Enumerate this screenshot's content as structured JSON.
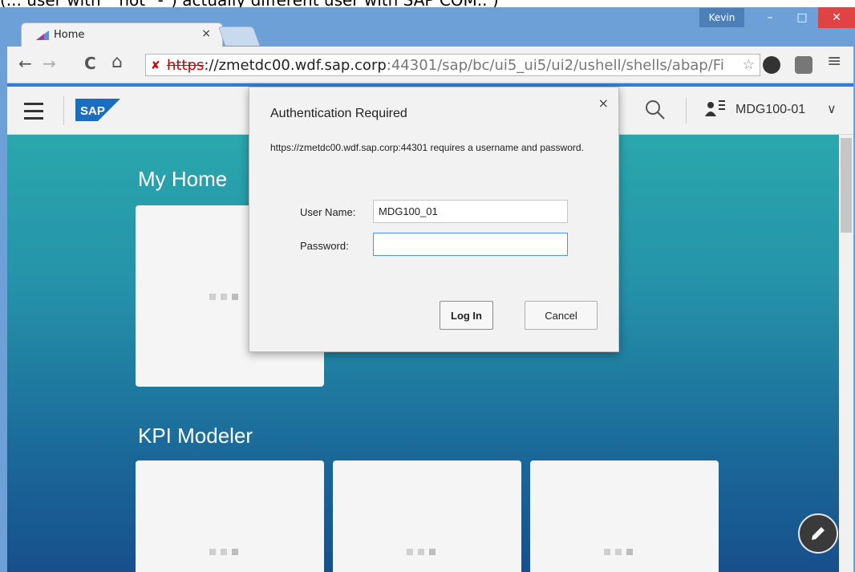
{
  "caption": {
    "prefix": "(... user with ",
    "underscore": "_",
    "suffix": " not \"-\") actually different user with SAP COM.. )"
  },
  "window": {
    "user_badge": "Kevin",
    "minimize_glyph": "–",
    "maximize_glyph": "□",
    "close_glyph": "✕"
  },
  "tab": {
    "title": "Home",
    "close_glyph": "×"
  },
  "toolbar": {
    "back_glyph": "←",
    "forward_glyph": "→",
    "reload_glyph": "C",
    "home_glyph": "⌂",
    "url_scheme": "https",
    "url_host": "://zmetdc00.wdf.sap.corp",
    "url_rest": ":44301/sap/bc/ui5_ui5/ui2/ushell/shells/abap/Fi",
    "star_glyph": "☆",
    "menu_glyph": "≡"
  },
  "shell": {
    "user_name": "MDG100-01",
    "user_glyph": "☰",
    "chevron_glyph": "∨",
    "logo_text": "SAP"
  },
  "content": {
    "groups": [
      {
        "title": "My Home"
      },
      {
        "title": "KPI Modeler"
      }
    ]
  },
  "dialog": {
    "title": "Authentication Required",
    "close_glyph": "×",
    "message": "https://zmetdc00.wdf.sap.corp:44301 requires a username and password.",
    "user_label": "User Name:",
    "user_value": "MDG100_01",
    "password_label": "Password:",
    "password_value": "",
    "login_label": "Log In",
    "cancel_label": "Cancel"
  },
  "colors": {
    "accent": "#2d7fd6",
    "window_frame": "#6ea0d8",
    "close_red": "#e04343",
    "sap_logo_blue": "#1b6ebd"
  }
}
